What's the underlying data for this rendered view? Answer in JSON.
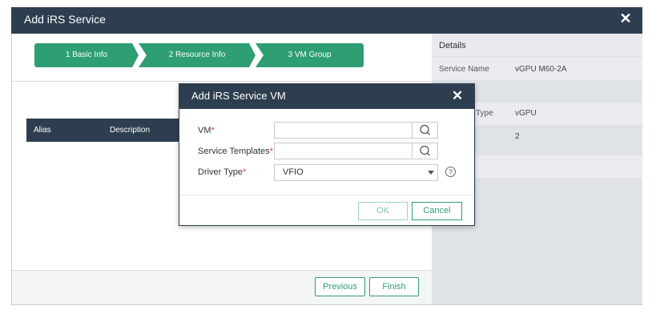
{
  "outer_dialog": {
    "title": "Add iRS Service"
  },
  "wizard": {
    "steps": [
      {
        "label": "1 Basic Info"
      },
      {
        "label": "2 Resource Info"
      },
      {
        "label": "3 VM Group"
      }
    ]
  },
  "table": {
    "columns": [
      "Alias",
      "Description"
    ]
  },
  "footer": {
    "previous_label": "Previous",
    "finish_label": "Finish"
  },
  "details": {
    "title": "Details",
    "rows": [
      {
        "label": "Service Name",
        "value": "vGPU M60-2A"
      },
      {
        "label": "n",
        "value": ""
      },
      {
        "label": "Type",
        "value": "vGPU"
      },
      {
        "label": "",
        "value": "2"
      }
    ]
  },
  "modal": {
    "title": "Add iRS Service VM",
    "fields": [
      {
        "label": "VM",
        "required": "*",
        "value": ""
      },
      {
        "label": "Service Templates",
        "required": "*",
        "value": ""
      }
    ],
    "driver_type": {
      "label": "Driver Type",
      "required": "*",
      "selected": "VFIO"
    },
    "help_glyph": "?",
    "ok_label": "OK",
    "cancel_label": "Cancel"
  },
  "colors": {
    "header_bg": "#2d3e50",
    "accent_green": "#2e9e73",
    "required_red": "#d9373f"
  },
  "icons": {
    "close": "close-icon",
    "search": "search-icon",
    "dropdown": "chevron-down-icon",
    "help": "help-icon"
  }
}
